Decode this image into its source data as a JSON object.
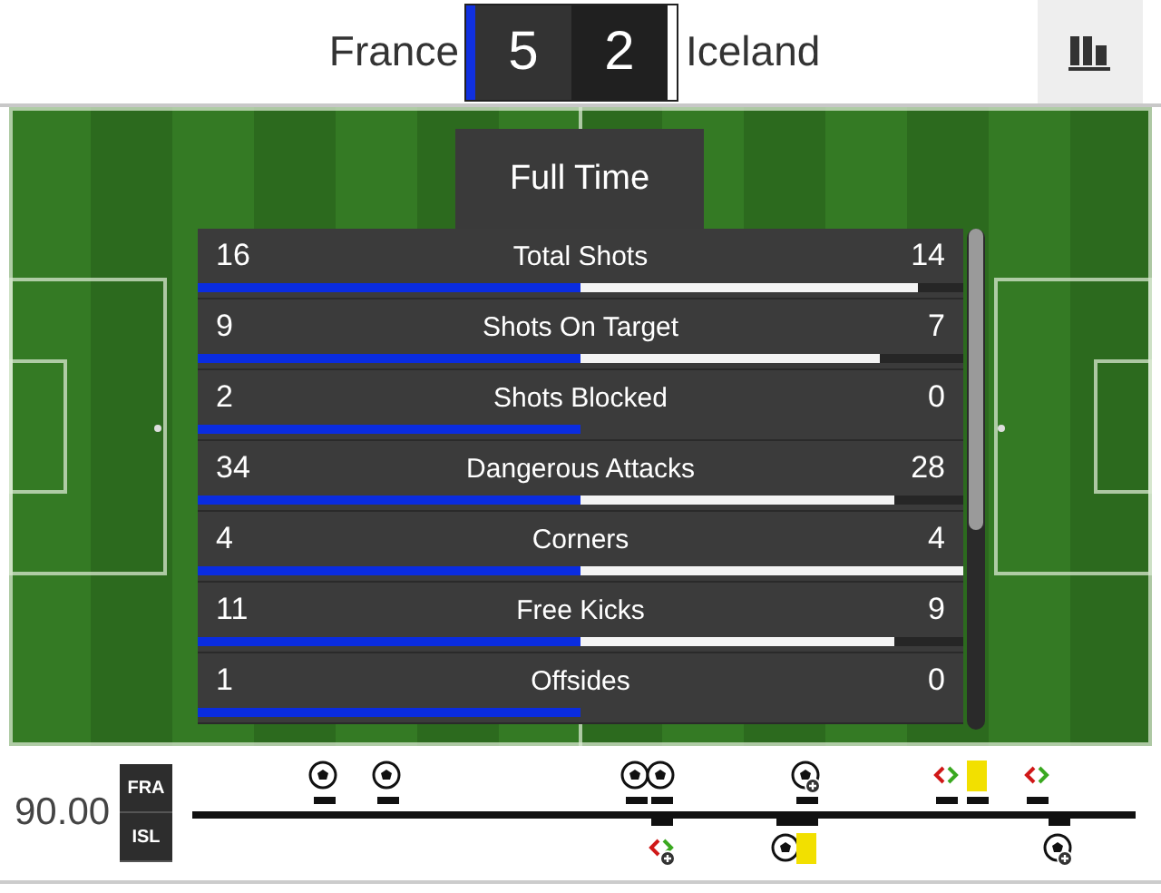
{
  "header": {
    "home": "France",
    "home_score": "5",
    "away_score": "2",
    "away": "Iceland"
  },
  "status": "Full Time",
  "stats": [
    {
      "home": "16",
      "label": "Total Shots",
      "away": "14",
      "away_bar": {
        "level": 0.88
      }
    },
    {
      "home": "9",
      "label": "Shots On Target",
      "away": "7",
      "away_bar": {
        "level": 0.78
      }
    },
    {
      "home": "2",
      "label": "Shots Blocked",
      "away": "0"
    },
    {
      "home": "34",
      "label": "Dangerous Attacks",
      "away": "28",
      "away_bar": {
        "level": 0.82
      }
    },
    {
      "home": "4",
      "label": "Corners",
      "away": "4",
      "away_bar": {
        "level": 1
      }
    },
    {
      "home": "11",
      "label": "Free Kicks",
      "away": "9",
      "away_bar": {
        "level": 0.82
      }
    },
    {
      "home": "1",
      "label": "Offsides",
      "away": "0"
    }
  ],
  "timeline": {
    "time": "90.00",
    "home_code": "FRA",
    "away_code": "ISL",
    "home_events": [
      {
        "kind": "goal",
        "level": 0.14
      },
      {
        "kind": "goal",
        "level": 0.208
      },
      {
        "kind": "goal",
        "level": 0.471
      },
      {
        "kind": "goal",
        "level": 0.498
      },
      {
        "kind": "goal-plus",
        "level": 0.652
      },
      {
        "kind": "substitution",
        "level": 0.8
      },
      {
        "kind": "yellow",
        "level": 0.833
      },
      {
        "kind": "substitution",
        "level": 0.896
      }
    ],
    "away_events": [
      {
        "kind": "substitution-plus",
        "level": 0.498
      },
      {
        "kind": "goal",
        "level": 0.631
      },
      {
        "kind": "yellow",
        "level": 0.652
      },
      {
        "kind": "goal-plus",
        "level": 0.919
      }
    ]
  }
}
